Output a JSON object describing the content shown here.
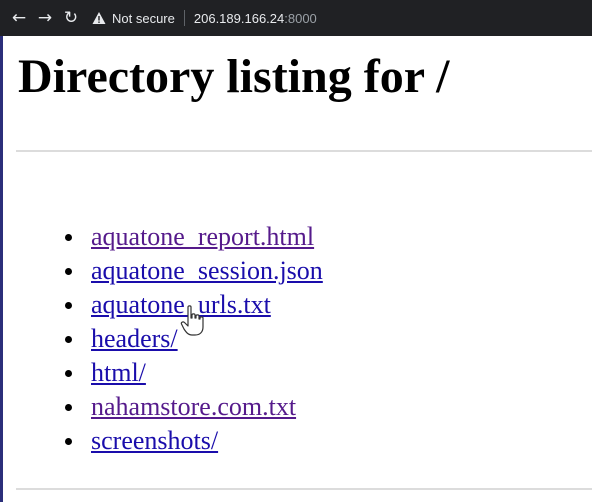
{
  "browser": {
    "security_label": "Not secure",
    "host": "206.189.166.24",
    "port": ":8000",
    "icons": [
      "back-arrow-icon",
      "forward-arrow-icon",
      "reload-icon",
      "warning-icon"
    ]
  },
  "page": {
    "title": "Directory listing for /",
    "entries": [
      {
        "label": "aquatone_report.html",
        "visited": true
      },
      {
        "label": "aquatone_session.json",
        "visited": false
      },
      {
        "label": "aquatone_urls.txt",
        "visited": false
      },
      {
        "label": "headers/",
        "visited": false
      },
      {
        "label": "html/",
        "visited": false
      },
      {
        "label": "nahamstore.com.txt",
        "visited": true
      },
      {
        "label": "screenshots/",
        "visited": false
      }
    ]
  },
  "colors": {
    "chrome_bg": "#202124",
    "link": "#1a0dab",
    "visited_link": "#551a8b"
  }
}
